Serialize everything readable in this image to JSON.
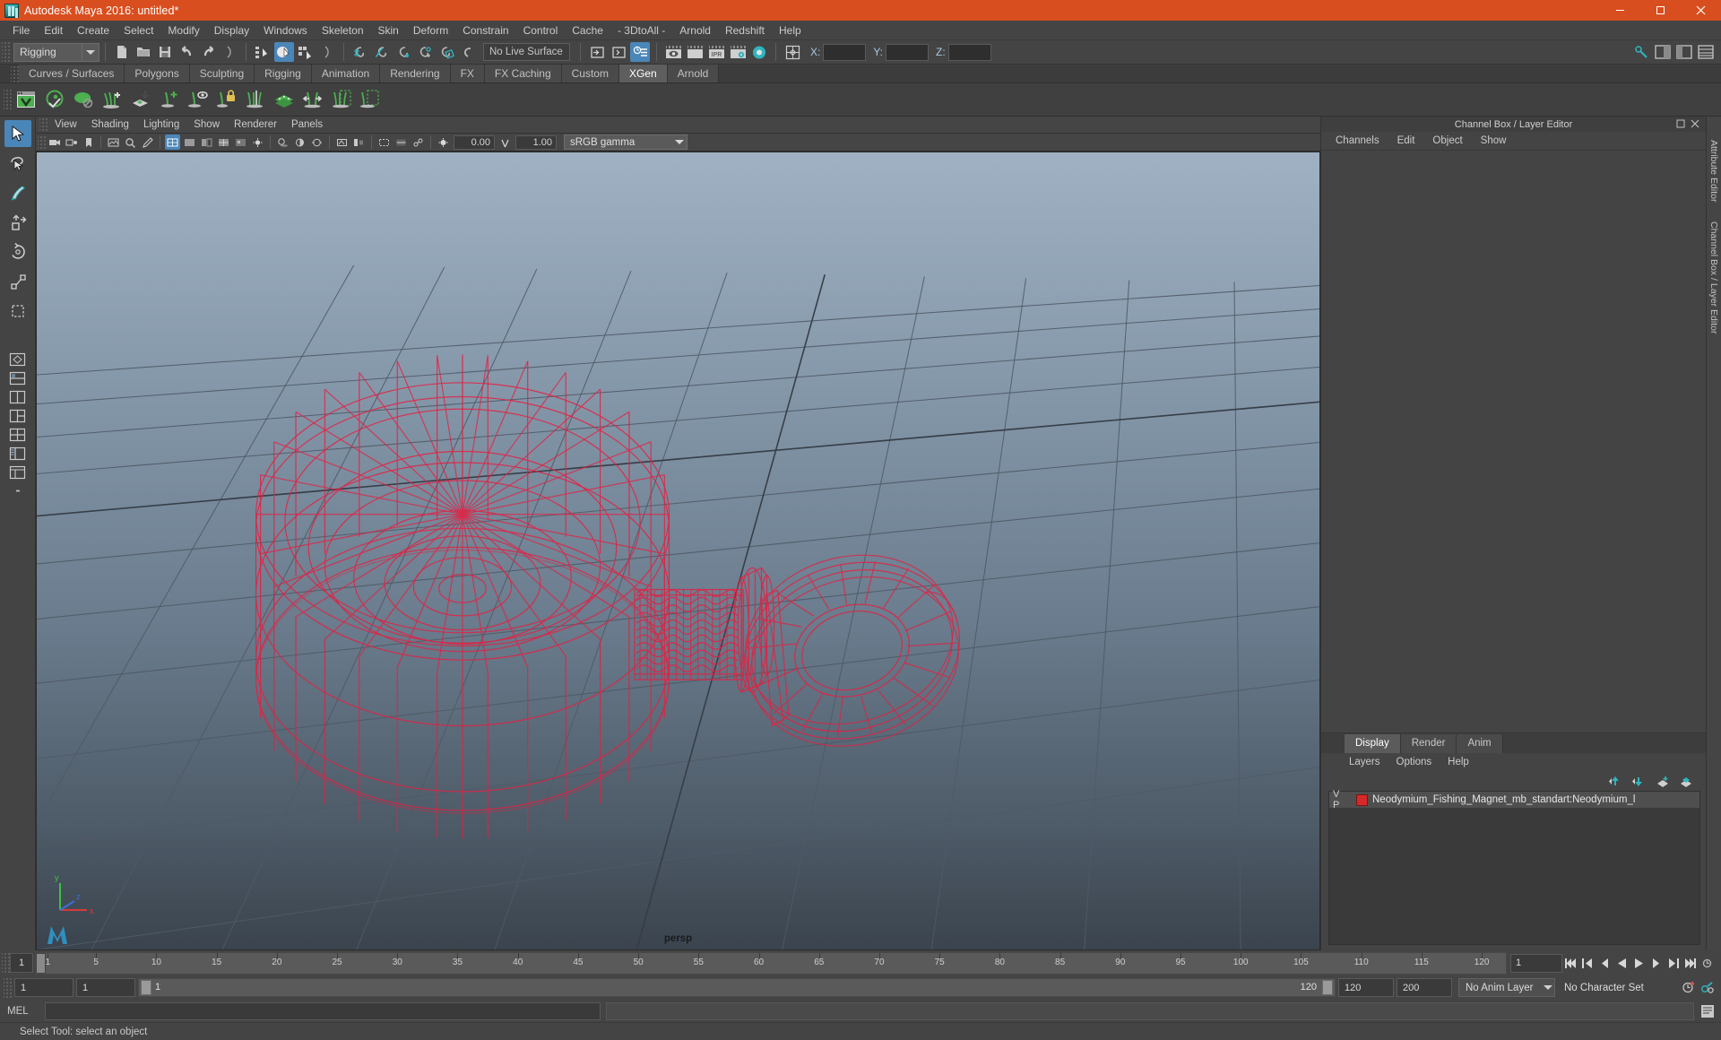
{
  "window": {
    "title": "Autodesk Maya 2016: untitled*",
    "icon": "maya-logo-icon",
    "minimize": "–",
    "maximize": "□",
    "close": "✕"
  },
  "menubar": {
    "items": [
      {
        "label": "File"
      },
      {
        "label": "Edit"
      },
      {
        "label": "Create"
      },
      {
        "label": "Select"
      },
      {
        "label": "Modify"
      },
      {
        "label": "Display"
      },
      {
        "label": "Windows"
      },
      {
        "label": "Skeleton"
      },
      {
        "label": "Skin"
      },
      {
        "label": "Deform"
      },
      {
        "label": "Constrain"
      },
      {
        "label": "Control"
      },
      {
        "label": "Cache"
      },
      {
        "label": "- 3DtoAll -"
      },
      {
        "label": "Arnold"
      },
      {
        "label": "Redshift"
      },
      {
        "label": "Help"
      }
    ]
  },
  "statusline": {
    "menuset": "Rigging",
    "live_surface": "No Live Surface",
    "coord_x_label": "X:",
    "coord_y_label": "Y:",
    "coord_z_label": "Z:",
    "coord_x_value": "",
    "coord_y_value": "",
    "coord_z_value": "",
    "ipr_label": "IPR"
  },
  "shelf": {
    "tabs": [
      {
        "label": "Curves / Surfaces",
        "active": false
      },
      {
        "label": "Polygons",
        "active": false
      },
      {
        "label": "Sculpting",
        "active": false
      },
      {
        "label": "Rigging",
        "active": false
      },
      {
        "label": "Animation",
        "active": false
      },
      {
        "label": "Rendering",
        "active": false
      },
      {
        "label": "FX",
        "active": false
      },
      {
        "label": "FX Caching",
        "active": false
      },
      {
        "label": "Custom",
        "active": false
      },
      {
        "label": "XGen",
        "active": true
      },
      {
        "label": "Arnold",
        "active": false
      }
    ],
    "icons": [
      "xgen-create-description-icon",
      "xgen-preview-icon",
      "xgen-solid-primitive-icon",
      "xgen-add-groom-icon",
      "xgen-import-collection-icon",
      "xgen-add-guide-icon",
      "xgen-eye-guide-icon",
      "xgen-lock-guide-icon",
      "xgen-part-guide-icon",
      "xgen-density-brush-icon",
      "xgen-width-brush-icon",
      "xgen-region-mask-icon",
      "xgen-clump-region-icon"
    ]
  },
  "toolbox": {
    "tools": [
      {
        "name": "select-tool",
        "active": true
      },
      {
        "name": "lasso-select-tool",
        "active": false
      },
      {
        "name": "paint-select-tool",
        "active": false
      },
      {
        "name": "move-tool",
        "active": false
      },
      {
        "name": "rotate-tool",
        "active": false
      },
      {
        "name": "scale-tool",
        "active": false
      },
      {
        "name": "last-tool",
        "active": false
      }
    ],
    "layouts": [
      {
        "name": "layout-single-icon"
      },
      {
        "name": "layout-two-stacked-icon"
      },
      {
        "name": "layout-two-side-icon"
      },
      {
        "name": "layout-three-icon"
      },
      {
        "name": "layout-four-icon"
      },
      {
        "name": "layout-outliner-persp-icon"
      },
      {
        "name": "layout-hypergraph-icon"
      },
      {
        "name": "layout-more-icon"
      }
    ]
  },
  "viewport": {
    "menus": [
      {
        "label": "View"
      },
      {
        "label": "Shading"
      },
      {
        "label": "Lighting"
      },
      {
        "label": "Show"
      },
      {
        "label": "Renderer"
      },
      {
        "label": "Panels"
      }
    ],
    "camera_label": "persp",
    "toolbar": {
      "exposure_value": "0.00",
      "gamma_value": "1.00",
      "color_management": "sRGB gamma"
    },
    "axis": {
      "x": "x",
      "y": "y",
      "z": "z"
    },
    "model": {
      "name": "Neodymium_Fishing_Magnet",
      "wireframe_color": "#e32244",
      "grid_color": "#4d5660"
    }
  },
  "rightpanel": {
    "title": "Channel Box / Layer Editor",
    "tabs": [
      {
        "label": "Channels"
      },
      {
        "label": "Edit"
      },
      {
        "label": "Object"
      },
      {
        "label": "Show"
      }
    ],
    "layer_editor": {
      "tabs": [
        {
          "label": "Display",
          "active": true
        },
        {
          "label": "Render",
          "active": false
        },
        {
          "label": "Anim",
          "active": false
        }
      ],
      "menus": [
        {
          "label": "Layers"
        },
        {
          "label": "Options"
        },
        {
          "label": "Help"
        }
      ],
      "columns": "V P",
      "layers": [
        {
          "visible": "V",
          "playback": "P",
          "color": "#d62828",
          "name": "Neodymium_Fishing_Magnet_mb_standart:Neodymium_l"
        }
      ]
    },
    "side_tabs": [
      {
        "label": "Attribute Editor"
      },
      {
        "label": "Channel Box / Layer Editor"
      }
    ]
  },
  "timeslider": {
    "start_display": "1",
    "current_frame": "1",
    "ticks": [
      {
        "label": "1",
        "frame": 1
      },
      {
        "label": "5",
        "frame": 5
      },
      {
        "label": "10",
        "frame": 10
      },
      {
        "label": "15",
        "frame": 15
      },
      {
        "label": "20",
        "frame": 20
      },
      {
        "label": "25",
        "frame": 25
      },
      {
        "label": "30",
        "frame": 30
      },
      {
        "label": "35",
        "frame": 35
      },
      {
        "label": "40",
        "frame": 40
      },
      {
        "label": "45",
        "frame": 45
      },
      {
        "label": "50",
        "frame": 50
      },
      {
        "label": "55",
        "frame": 55
      },
      {
        "label": "60",
        "frame": 60
      },
      {
        "label": "65",
        "frame": 65
      },
      {
        "label": "70",
        "frame": 70
      },
      {
        "label": "75",
        "frame": 75
      },
      {
        "label": "80",
        "frame": 80
      },
      {
        "label": "85",
        "frame": 85
      },
      {
        "label": "90",
        "frame": 90
      },
      {
        "label": "95",
        "frame": 95
      },
      {
        "label": "100",
        "frame": 100
      },
      {
        "label": "105",
        "frame": 105
      },
      {
        "label": "110",
        "frame": 110
      },
      {
        "label": "115",
        "frame": 115
      },
      {
        "label": "120",
        "frame": 120
      }
    ],
    "frame_field": "1",
    "playback_buttons": [
      "go-to-start-icon",
      "step-back-key-icon",
      "step-back-frame-icon",
      "play-backwards-icon",
      "play-forwards-icon",
      "step-forward-frame-icon",
      "step-forward-key-icon",
      "go-to-end-icon"
    ]
  },
  "rangeslider": {
    "anim_start": "1",
    "range_start": "1",
    "range_bar_start_label": "1",
    "range_bar_end_label": "120",
    "range_end": "120",
    "anim_end": "200",
    "anim_layer": "No Anim Layer",
    "character_set": "No Character Set",
    "auto_key_icon": "auto-keyframe-icon",
    "prefs_icon": "animation-preferences-icon"
  },
  "commandline": {
    "language_label": "MEL",
    "input_value": "",
    "output_value": "",
    "script_editor_icon": "script-editor-icon"
  },
  "helpline": {
    "text": "Select Tool: select an object"
  },
  "colors": {
    "title_bar": "#d94e1f",
    "accent_blue": "#4a86b8",
    "panel_bg": "#444444",
    "shelf_green": "#5aa05a",
    "teal": "#2fb5bd",
    "wire_red": "#e32244"
  }
}
